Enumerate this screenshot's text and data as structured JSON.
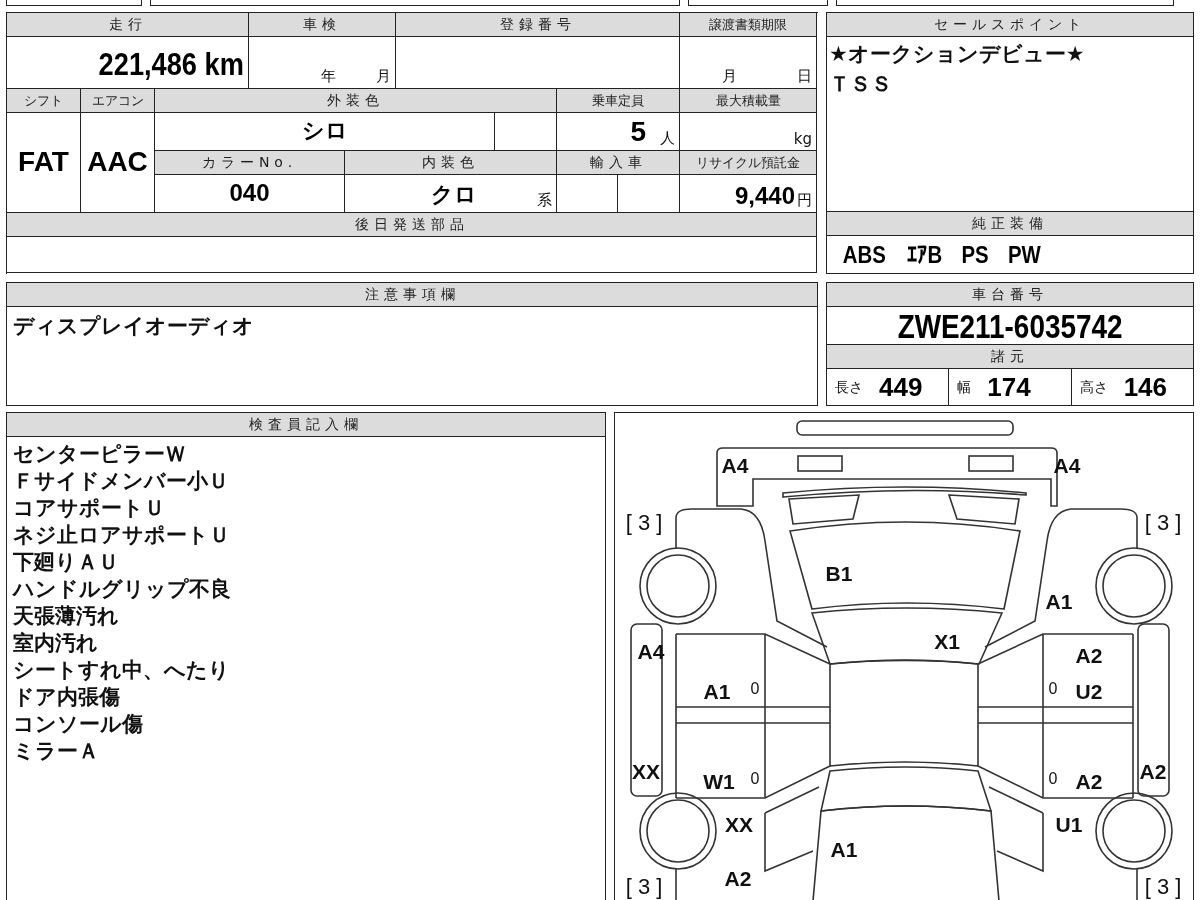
{
  "vehicle_info": {
    "mileage": {
      "label": "走行",
      "value": "221,486",
      "unit": "km"
    },
    "inspection": {
      "label": "車検",
      "year_unit": "年",
      "month_unit": "月"
    },
    "registration_number": {
      "label": "登録番号"
    },
    "transfer_deadline": {
      "label": "譲渡書類期限",
      "month_unit": "月",
      "day_unit": "日"
    },
    "shift": {
      "label": "シフト",
      "value": "FAT"
    },
    "air_conditioner": {
      "label": "エアコン",
      "value": "AAC"
    },
    "exterior_color": {
      "label": "外装色",
      "value": "シロ"
    },
    "capacity": {
      "label": "乗車定員",
      "value": "5",
      "unit": "人"
    },
    "max_load": {
      "label": "最大積載量",
      "unit": "kg"
    },
    "color_number": {
      "label": "カラーNo.",
      "value": "040"
    },
    "interior_color": {
      "label": "内装色",
      "value": "クロ",
      "suffix": "系"
    },
    "imported": {
      "label": "輸入車"
    },
    "recycling_fee": {
      "label": "リサイクル預託金",
      "value": "9,440",
      "unit": "円"
    },
    "parts_sent_later": {
      "label": "後日発送部品"
    }
  },
  "sales_points": {
    "label": "セールスポイント",
    "lines": [
      "★オークションデビュー★",
      "ＴＳＳ"
    ]
  },
  "standard_equipment": {
    "label": "純正装備",
    "items": [
      "ABS",
      "ｴｱB",
      "PS",
      "PW"
    ]
  },
  "notes": {
    "label": "注意事項欄",
    "text": "ディスプレイオーディオ"
  },
  "chassis": {
    "label": "車台番号",
    "value": "ZWE211-6035742"
  },
  "specs": {
    "label": "諸元",
    "items": [
      {
        "label": "長さ",
        "value": "449"
      },
      {
        "label": "幅",
        "value": "174"
      },
      {
        "label": "高さ",
        "value": "146"
      }
    ]
  },
  "inspector_notes": {
    "label": "検査員記入欄",
    "lines": [
      "センターピラーＷ",
      "Ｆサイドメンバー小Ｕ",
      "コアサポートＵ",
      "ネジ止ロアサポートＵ",
      "下廻りＡＵ",
      "ハンドルグリップ不良",
      "天張薄汚れ",
      "室内汚れ",
      "シートすれ中、へたり",
      "ドア内張傷",
      "コンソール傷",
      "ミラーＡ"
    ]
  },
  "diagram": {
    "marks": [
      {
        "text": "A4"
      },
      {
        "text": "A4"
      },
      {
        "text": "[ 3 ]"
      },
      {
        "text": "[ 3 ]"
      },
      {
        "text": "B1"
      },
      {
        "text": "A1"
      },
      {
        "text": "X1"
      },
      {
        "text": "A4"
      },
      {
        "text": "A2"
      },
      {
        "text": "A1"
      },
      {
        "text": "0"
      },
      {
        "text": "0"
      },
      {
        "text": "U2"
      },
      {
        "text": "XX"
      },
      {
        "text": "A2"
      },
      {
        "text": "W1"
      },
      {
        "text": "0"
      },
      {
        "text": "0"
      },
      {
        "text": "A2"
      },
      {
        "text": "XX"
      },
      {
        "text": "U1"
      },
      {
        "text": "A1"
      },
      {
        "text": "A2"
      },
      {
        "text": "[ 3 ]"
      },
      {
        "text": "[ 3 ]"
      }
    ]
  }
}
